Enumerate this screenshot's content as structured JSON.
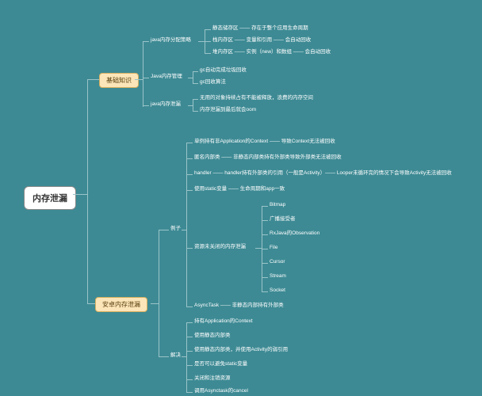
{
  "root": "内存泄漏",
  "branches": {
    "basics": {
      "label": "基础知识",
      "children": {
        "alloc_strategy": {
          "label": "java内存分配策略",
          "children": {
            "static_zone": "静态储存区 —— 存在于整个应用生命周期",
            "stack_zone": "栈内存区 —— 变量和引用 —— 会自动回收",
            "heap_zone": "堆内存区 —— 实例（new）和数组 —— 会自动回收"
          }
        },
        "mgmt": {
          "label": "Java内存管理",
          "children": {
            "gc_auto": "gc自动完成垃圾回收",
            "gc_algo": "gc回收算法"
          }
        },
        "leak": {
          "label": "java内存泄漏",
          "children": {
            "no_release": "无用的对象持续占有不能被释放，浪费的内存空间",
            "oom": "内存泄漏到最后就会oom"
          }
        }
      }
    },
    "android": {
      "label": "安卓内存泄漏",
      "children": {
        "cases": {
          "label": "例子",
          "children": {
            "singleton": "单例持有非Application的Context —— 导致Context无法被回收",
            "anon_inner": "匿名内部类 —— 非静态内部类持有外部类导致外部类无法被回收",
            "handler": "handler —— handler持有外部类的引用（一般是Activity）—— Looper未循环完的情况下会导致Activity无法被回收",
            "static_var": "使用static变量 —— 生命周期和app一致",
            "unclosed": {
              "label": "资源未关闭的内存泄漏",
              "items": {
                "bitmap": "Bitmap",
                "broadcast": "广播接受者",
                "rxjava": "RxJava的Observation",
                "file": "File",
                "cursor": "Cursor",
                "stream": "Stream",
                "socket": "Socket"
              }
            },
            "asynctask": "AsyncTask —— 非静态内部持有外部类"
          }
        },
        "solve": {
          "label": "解决",
          "children": {
            "app_ctx": "持有Application的Context",
            "static_inner": "使用静态内部类",
            "static_weak": "使用静态内部类，并使用Activity的弱引用",
            "avoid_static": "是否可以避免static变量",
            "close_unreg": "关闭和注销资源",
            "cancel_async": "调用Asynctask的cancel"
          }
        }
      }
    }
  }
}
